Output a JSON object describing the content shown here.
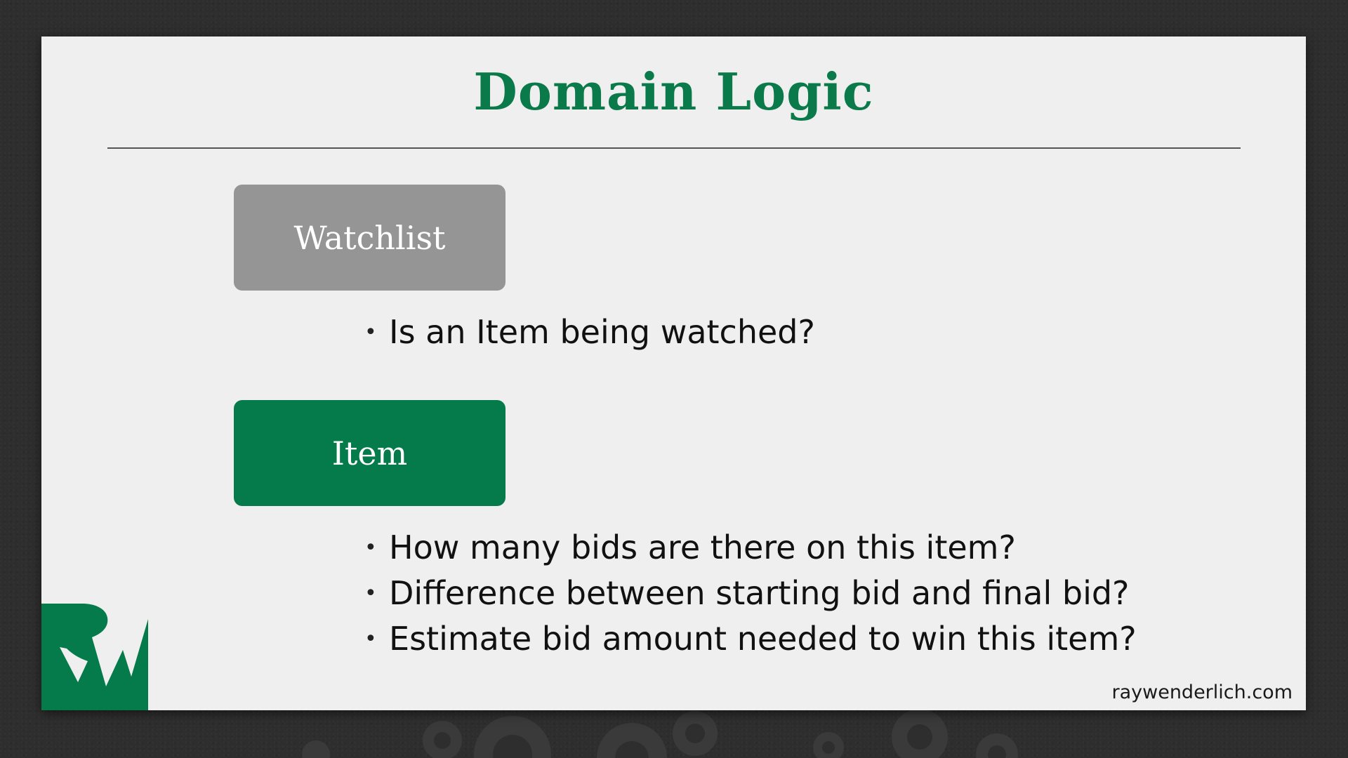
{
  "slide": {
    "title": "Domain Logic",
    "sections": [
      {
        "label": "Watchlist",
        "bullets": [
          "Is an Item being watched?"
        ]
      },
      {
        "label": "Item",
        "bullets": [
          "How many bids are there on this item?",
          "Difference between starting bid and final bid?",
          "Estimate bid amount needed to win this item?"
        ]
      }
    ],
    "footer_url": "raywenderlich.com",
    "bullet_char": "•",
    "logo_icon": "raywenderlich-logo-icon"
  },
  "colors": {
    "accent_green": "#0a7a4a",
    "box_gray": "#959595",
    "box_green": "#057a4a",
    "slide_bg": "#efefef",
    "backdrop": "#2e2e2e"
  }
}
